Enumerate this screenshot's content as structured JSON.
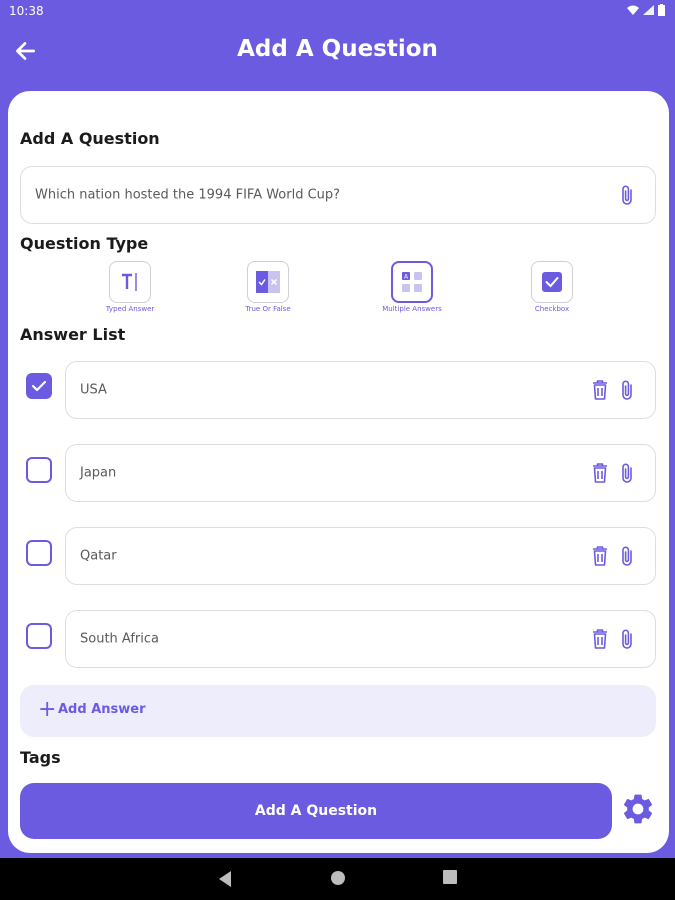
{
  "status_bar": {
    "time": "10:38"
  },
  "app_bar": {
    "title": "Add A Question"
  },
  "question": {
    "section_title": "Add A Question",
    "text": "Which nation hosted the 1994 FIFA World Cup?"
  },
  "question_type": {
    "section_title": "Question Type",
    "options": [
      {
        "label": "Typed Answer",
        "selected": false
      },
      {
        "label": "True Or False",
        "selected": false
      },
      {
        "label": "Multiple Answers",
        "selected": true
      },
      {
        "label": "Checkbox",
        "selected": false
      }
    ]
  },
  "answers": {
    "section_title": "Answer List",
    "items": [
      {
        "text": "USA",
        "correct": true
      },
      {
        "text": "Japan",
        "correct": false
      },
      {
        "text": "Qatar",
        "correct": false
      },
      {
        "text": "South Africa",
        "correct": false
      }
    ],
    "add_label": "Add Answer"
  },
  "tags": {
    "section_title": "Tags"
  },
  "submit": {
    "label": "Add A Question"
  },
  "colors": {
    "accent": "#6B5BE0",
    "accent_light": "#EEEDFB"
  },
  "icons": [
    "back-arrow-icon",
    "attach-icon",
    "trash-icon",
    "check-icon",
    "plus-icon",
    "gear-icon",
    "wifi-icon",
    "signal-icon",
    "battery-icon"
  ]
}
